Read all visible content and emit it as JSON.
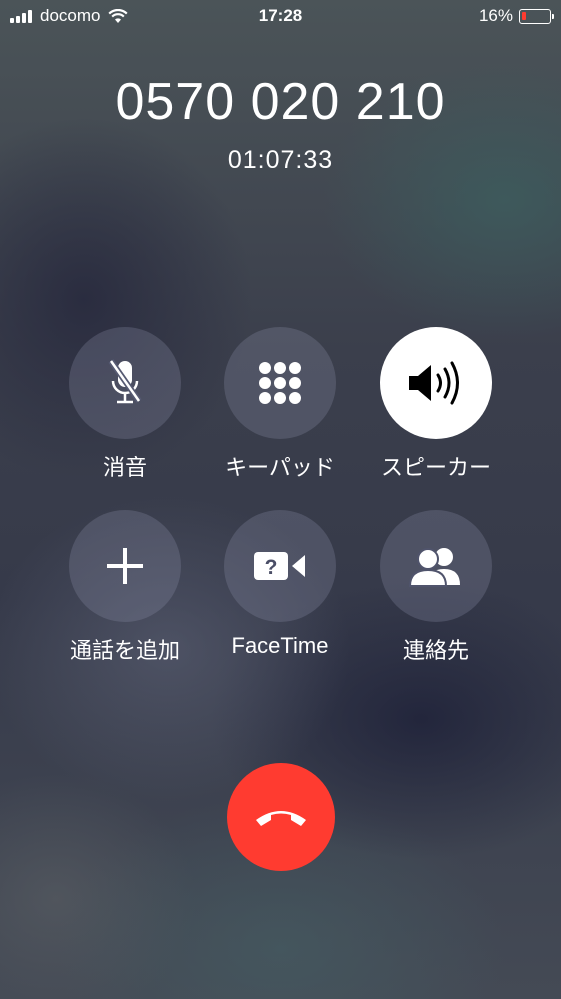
{
  "status_bar": {
    "carrier": "docomo",
    "time": "17:28",
    "battery_percent": "16%",
    "battery_level": 0.16,
    "battery_color": "#ff3b30"
  },
  "call": {
    "number": "0570 020 210",
    "duration": "01:07:33"
  },
  "controls": [
    {
      "label": "消音",
      "icon": "mic-muted-icon",
      "active": false
    },
    {
      "label": "キーパッド",
      "icon": "keypad-icon",
      "active": false
    },
    {
      "label": "スピーカー",
      "icon": "speaker-icon",
      "active": true
    },
    {
      "label": "通話を追加",
      "icon": "plus-icon",
      "active": false
    },
    {
      "label": "FaceTime",
      "icon": "facetime-icon",
      "active": false
    },
    {
      "label": "連絡先",
      "icon": "contacts-icon",
      "active": false
    }
  ],
  "end_call": {
    "icon": "hang-up-icon",
    "color": "#ff3b30"
  }
}
